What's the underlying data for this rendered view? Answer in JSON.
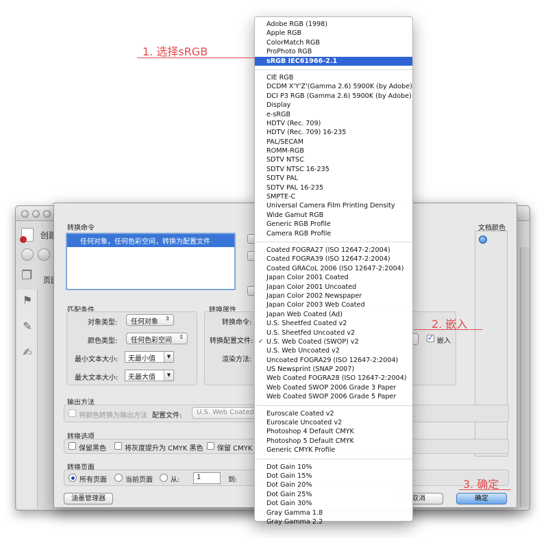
{
  "background_window": {
    "title": "创建",
    "page_tab": "页面"
  },
  "dialog": {
    "convert_commands_label": "转换命令",
    "commands": [
      "任何对象，任何色彩空间，转换为配置文件"
    ],
    "match_conditions": {
      "label": "匹配条件",
      "object_type_label": "对象类型:",
      "object_type_value": "任何对象",
      "color_type_label": "颜色类型:",
      "color_type_value": "任何色彩空间",
      "min_text_label": "最小文本大小:",
      "min_text_value": "无最小值",
      "max_text_label": "最大文本大小:",
      "max_text_value": "无最大值"
    },
    "conversion_attributes": {
      "label": "转换属性",
      "command_label": "转换命令:",
      "profile_label": "转换配置文件:",
      "rendering_label": "渲染方法:",
      "embed_label": "嵌入",
      "embed_checked": true
    },
    "doc_colors_label": "文档颜色",
    "output_method": {
      "label": "输出方法",
      "convert_checkbox_label": "将颜色转换为输出方法",
      "config_label": "配置文件:",
      "config_value": "U.S. Web Coated (SW"
    },
    "conversion_options": {
      "label": "转换选项",
      "keep_black": "保留黑色",
      "promote_gray": "将灰度提升为 CMYK 黑色",
      "keep_cmyk": "保留 CMYK 原"
    },
    "convert_pages": {
      "label": "转换页面",
      "all_pages": "所有页面",
      "current_page": "当前页面",
      "from_label": "从:",
      "from_value": "1",
      "to_label": "到:",
      "selected": "all"
    },
    "ink_manager_button": "油墨管理器",
    "cancel_button": "取消",
    "ok_button": "确定"
  },
  "menu": {
    "groups": [
      [
        "Adobe RGB (1998)",
        "Apple RGB",
        "ColorMatch RGB",
        "ProPhoto RGB",
        "sRGB IEC61966-2.1"
      ],
      [
        "CIE RGB",
        "DCDM X'Y'Z'(Gamma 2.6) 5900K (by Adobe)",
        "DCI P3 RGB (Gamma 2.6) 5900K (by Adobe)",
        "Display",
        "e-sRGB",
        "HDTV (Rec. 709)",
        "HDTV (Rec. 709) 16-235",
        "PAL/SECAM",
        "ROMM-RGB",
        "SDTV NTSC",
        "SDTV NTSC 16-235",
        "SDTV PAL",
        "SDTV PAL 16-235",
        "SMPTE-C",
        "Universal Camera Film Printing Density",
        "Wide Gamut RGB",
        "Generic RGB Profile",
        "Camera RGB Profile"
      ],
      [
        "Coated FOGRA27 (ISO 12647-2:2004)",
        "Coated FOGRA39 (ISO 12647-2:2004)",
        "Coated GRACoL 2006 (ISO 12647-2:2004)",
        "Japan Color 2001 Coated",
        "Japan Color 2001 Uncoated",
        "Japan Color 2002 Newspaper",
        "Japan Color 2003 Web Coated",
        "Japan Web Coated (Ad)",
        "U.S. Sheetfed Coated v2",
        "U.S. Sheetfed Uncoated v2",
        "U.S. Web Coated (SWOP) v2",
        "U.S. Web Uncoated v2",
        "Uncoated FOGRA29 (ISO 12647-2:2004)",
        "US Newsprint (SNAP 2007)",
        "Web Coated FOGRA28 (ISO 12647-2:2004)",
        "Web Coated SWOP 2006 Grade 3 Paper",
        "Web Coated SWOP 2006 Grade 5 Paper"
      ],
      [
        "Euroscale Coated v2",
        "Euroscale Uncoated v2",
        "Photoshop 4 Default CMYK",
        "Photoshop 5 Default CMYK",
        "Generic CMYK Profile"
      ],
      [
        "Dot Gain 10%",
        "Dot Gain 15%",
        "Dot Gain 20%",
        "Dot Gain 25%",
        "Dot Gain 30%",
        "Gray Gamma 1.8",
        "Gray Gamma 2.2"
      ]
    ],
    "selected_item": "sRGB IEC61966-2.1",
    "checked_item": "U.S. Web Coated (SWOP) v2"
  },
  "annotations": {
    "step1": "1. 选择sRGB",
    "step2": "2. 嵌入",
    "step3": "3. 确定",
    "color": "#e24b4b"
  }
}
